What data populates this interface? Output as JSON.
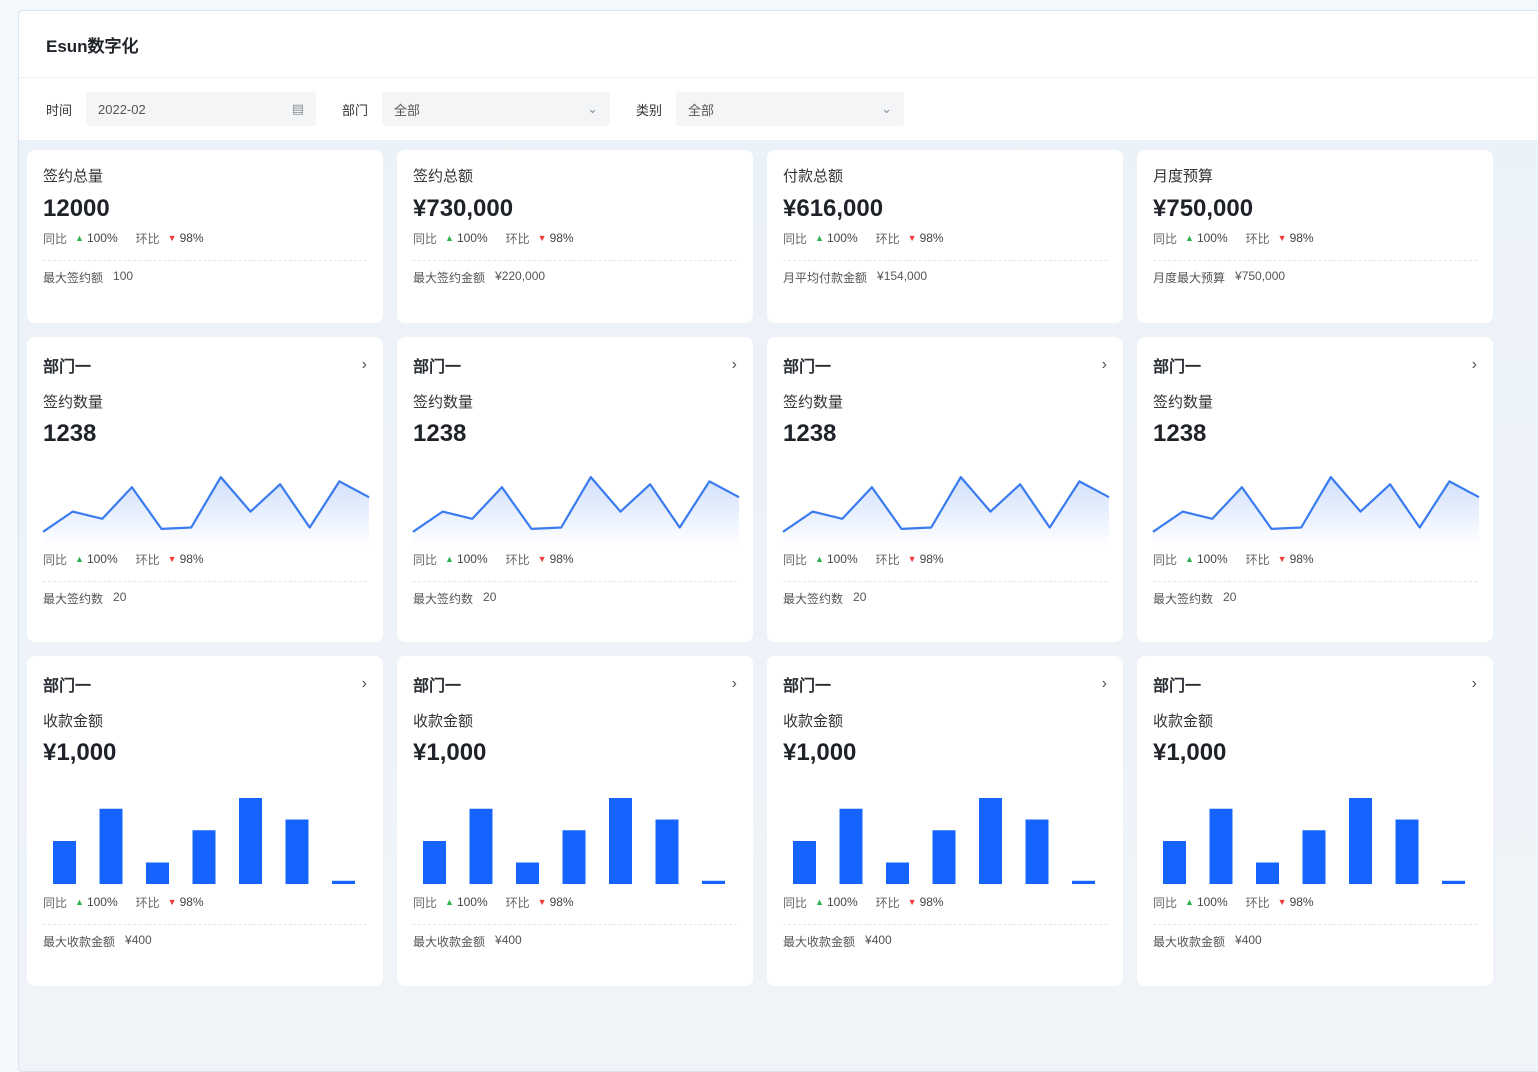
{
  "app": {
    "title": "Esun数字化"
  },
  "filters": {
    "time": {
      "label": "时间",
      "value": "2022-02",
      "icon": "calendar-icon"
    },
    "department": {
      "label": "部门",
      "value": "全部",
      "icon": "chevron-down-icon"
    },
    "category": {
      "label": "类别",
      "value": "全部",
      "icon": "chevron-down-icon"
    }
  },
  "compare_labels": {
    "yoy": "同比",
    "mom": "环比",
    "yoy_value": "100%",
    "mom_value": "98%"
  },
  "summary_cards": [
    {
      "title": "签约总量",
      "value": "12000",
      "foot_label": "最大签约额",
      "foot_value": "100"
    },
    {
      "title": "签约总额",
      "value": "¥730,000",
      "foot_label": "最大签约金额",
      "foot_value": "¥220,000"
    },
    {
      "title": "付款总额",
      "value": "¥616,000",
      "foot_label": "月平均付款金额",
      "foot_value": "¥154,000"
    },
    {
      "title": "月度预算",
      "value": "¥750,000",
      "foot_label": "月度最大预算",
      "foot_value": "¥750,000"
    }
  ],
  "line_cards": [
    {
      "dept": "部门一",
      "metric": "签约数量",
      "value": "1238",
      "foot_label": "最大签约数",
      "foot_value": "20"
    },
    {
      "dept": "部门一",
      "metric": "签约数量",
      "value": "1238",
      "foot_label": "最大签约数",
      "foot_value": "20"
    },
    {
      "dept": "部门一",
      "metric": "签约数量",
      "value": "1238",
      "foot_label": "最大签约数",
      "foot_value": "20"
    },
    {
      "dept": "部门一",
      "metric": "签约数量",
      "value": "1238",
      "foot_label": "最大签约数",
      "foot_value": "20"
    }
  ],
  "bar_cards": [
    {
      "dept": "部门一",
      "metric": "收款金额",
      "value": "¥1,000",
      "foot_label": "最大收款金额",
      "foot_value": "¥400"
    },
    {
      "dept": "部门一",
      "metric": "收款金额",
      "value": "¥1,000",
      "foot_label": "最大收款金额",
      "foot_value": "¥400"
    },
    {
      "dept": "部门一",
      "metric": "收款金额",
      "value": "¥1,000",
      "foot_label": "最大收款金额",
      "foot_value": "¥400"
    },
    {
      "dept": "部门一",
      "metric": "收款金额",
      "value": "¥1,000",
      "foot_label": "最大收款金额",
      "foot_value": "¥400"
    }
  ],
  "colors": {
    "accent": "#1664ff",
    "line": "#3a7bf0",
    "up": "#2bb24c",
    "down": "#f23c3c"
  },
  "chart_data": [
    {
      "type": "area",
      "values": [
        10,
        38,
        28,
        72,
        14,
        16,
        86,
        38,
        76,
        16,
        80,
        58
      ]
    },
    {
      "type": "bar",
      "values": [
        40,
        70,
        20,
        50,
        80,
        60,
        3
      ]
    }
  ]
}
